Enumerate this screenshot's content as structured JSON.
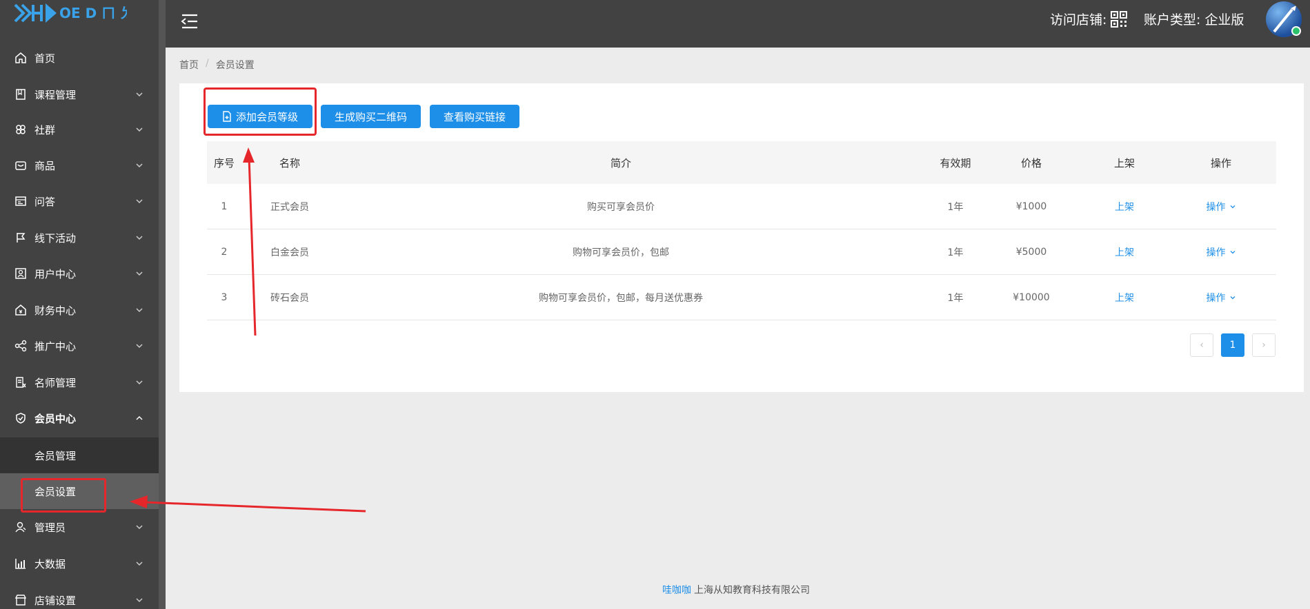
{
  "sidebar": {
    "items": [
      {
        "label": "首页",
        "icon": "home-icon"
      },
      {
        "label": "课程管理",
        "icon": "book-icon"
      },
      {
        "label": "社群",
        "icon": "community-icon"
      },
      {
        "label": "商品",
        "icon": "goods-icon"
      },
      {
        "label": "问答",
        "icon": "qa-icon"
      },
      {
        "label": "线下活动",
        "icon": "flag-icon"
      },
      {
        "label": "用户中心",
        "icon": "user-card-icon"
      },
      {
        "label": "财务中心",
        "icon": "finance-icon"
      },
      {
        "label": "推广中心",
        "icon": "share-icon"
      },
      {
        "label": "名师管理",
        "icon": "teacher-icon"
      },
      {
        "label": "会员中心",
        "icon": "shield-icon"
      },
      {
        "label": "管理员",
        "icon": "admin-icon"
      },
      {
        "label": "大数据",
        "icon": "chart-icon"
      },
      {
        "label": "店铺设置",
        "icon": "store-icon"
      }
    ],
    "sub_items": [
      {
        "label": "会员管理"
      },
      {
        "label": "会员设置"
      }
    ]
  },
  "header": {
    "visit_store": "访问店铺:",
    "account_type": "账户类型:  企业版"
  },
  "breadcrumb": {
    "home": "首页",
    "separator": "/",
    "current": "会员设置"
  },
  "toolbar": {
    "add_label": "添加会员等级",
    "qr_label": "生成购买二维码",
    "link_label": "查看购买链接"
  },
  "table": {
    "headers": [
      "序号",
      "名称",
      "简介",
      "有效期",
      "价格",
      "上架",
      "操作"
    ],
    "rows": [
      {
        "index": "1",
        "name": "正式会员",
        "desc": "购买可享会员价",
        "validity": "1年",
        "price": "¥1000",
        "shelf": "上架",
        "action": "操作"
      },
      {
        "index": "2",
        "name": "白金会员",
        "desc": "购物可享会员价，包邮",
        "validity": "1年",
        "price": "¥5000",
        "shelf": "上架",
        "action": "操作"
      },
      {
        "index": "3",
        "name": "砖石会员",
        "desc": "购物可享会员价，包邮，每月送优惠券",
        "validity": "1年",
        "price": "¥10000",
        "shelf": "上架",
        "action": "操作"
      }
    ]
  },
  "pagination": {
    "prev": "‹",
    "current": "1",
    "next": "›"
  },
  "footer": {
    "brand": "哇咖咖",
    "company": "上海从知教育科技有限公司"
  },
  "colors": {
    "primary": "#1e8fe8",
    "sidebar_bg": "#424242",
    "highlight": "#e5262b"
  }
}
